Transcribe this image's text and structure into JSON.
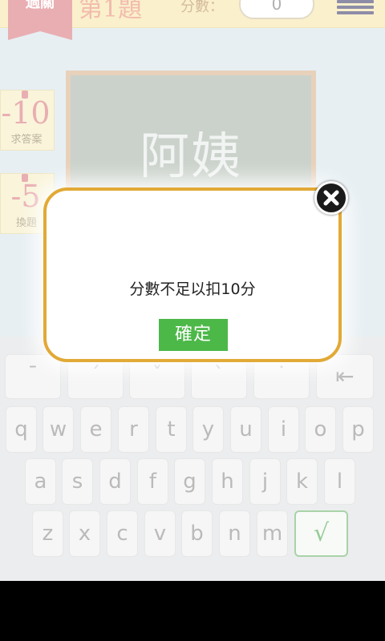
{
  "topbar": {
    "ribbon_text": "過關",
    "question_title": "第1題",
    "score_label": "分數：",
    "score_value": "0"
  },
  "side": {
    "hint": {
      "value": "-10",
      "label": "求答案"
    },
    "skip": {
      "value": "-5",
      "label": "換題"
    }
  },
  "board": {
    "word": "阿姨"
  },
  "keyboard": {
    "row0": [
      "ˉ",
      "ˊ",
      "ˇ",
      "ˋ",
      "˙",
      "⇤"
    ],
    "row1": [
      "q",
      "w",
      "e",
      "r",
      "t",
      "y",
      "u",
      "i",
      "o",
      "p"
    ],
    "row2": [
      "a",
      "s",
      "d",
      "f",
      "g",
      "h",
      "j",
      "k",
      "l"
    ],
    "row3": [
      "z",
      "x",
      "c",
      "v",
      "b",
      "n",
      "m"
    ],
    "confirm_key": "√"
  },
  "dialog": {
    "message": "分數不足以扣10分",
    "confirm_label": "確定"
  },
  "colors": {
    "accent_green": "#4cb848",
    "dialog_border": "#e2a936",
    "ribbon": "#d9747a"
  }
}
